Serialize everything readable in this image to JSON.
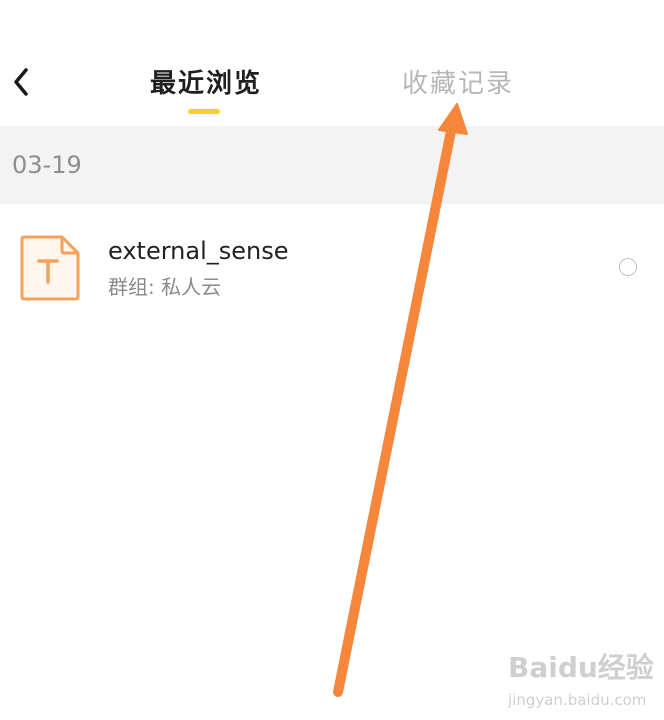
{
  "header": {
    "back_icon": "chevron-left-icon",
    "tabs": [
      {
        "label": "最近浏览",
        "active": true
      },
      {
        "label": "收藏记录",
        "active": false
      }
    ],
    "active_color": "#1f1f1f",
    "inactive_color": "#b7b7b7",
    "indicator_color": "#f7d21a"
  },
  "section": {
    "date": "03-19"
  },
  "files": [
    {
      "name": "external_sense",
      "group": "群组: 私人云",
      "icon": "text-document-icon",
      "icon_letter": "T",
      "icon_color": "#f2a25c",
      "selected": false
    }
  ],
  "annotation": {
    "arrow_color": "#f5863a"
  },
  "watermark": {
    "brand": "Baidu经验",
    "url": "jingyan.baidu.com"
  }
}
